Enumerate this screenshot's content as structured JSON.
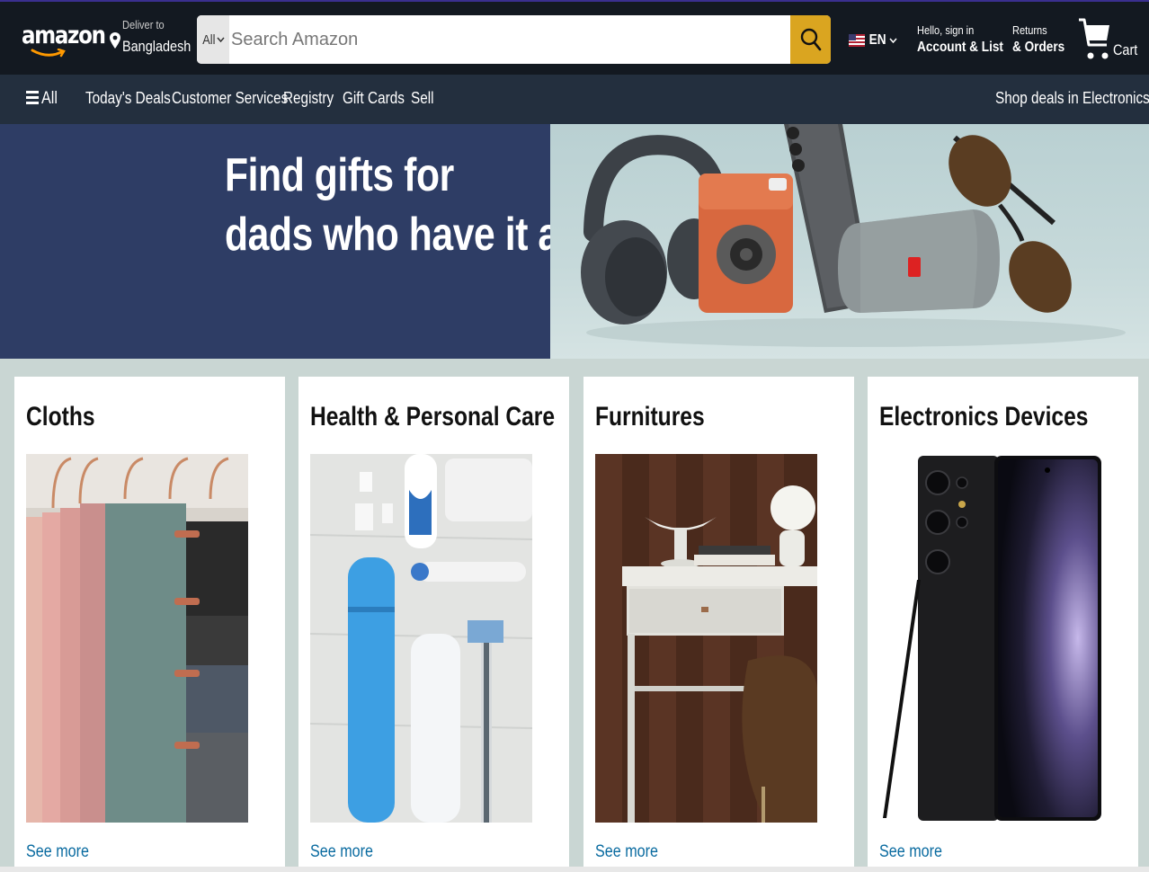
{
  "header": {
    "logo_text": "amazon",
    "deliver": {
      "line1": "Deliver to",
      "line2": "Bangladesh"
    },
    "search": {
      "category": "All",
      "placeholder": "Search Amazon"
    },
    "language": "EN",
    "account": {
      "line1": "Hello, sign in",
      "line2": "Account & List"
    },
    "orders": {
      "line1": "Returns",
      "line2": "& Orders"
    },
    "cart": {
      "label": "Cart"
    }
  },
  "subnav": {
    "all": "All",
    "items": [
      "Today's Deals",
      "Customer Services",
      "Registry",
      "Gift Cards",
      "Sell"
    ],
    "right": "Shop deals in Electronics"
  },
  "hero": {
    "line1": "Find gifts for",
    "line2": "dads who have it all"
  },
  "cards": [
    {
      "title": "Cloths",
      "link": "See more"
    },
    {
      "title": "Health & Personal Care",
      "link": "See more"
    },
    {
      "title": "Furnitures",
      "link": "See more"
    },
    {
      "title": "Electronics Devices",
      "link": "See more"
    }
  ],
  "colors": {
    "topbar": "#131921",
    "subnav": "#232f3e",
    "search_button": "#daa520",
    "hero_left": "#2e3d65",
    "link": "#0a6ba0",
    "page_bg": "#c9d6d3"
  }
}
